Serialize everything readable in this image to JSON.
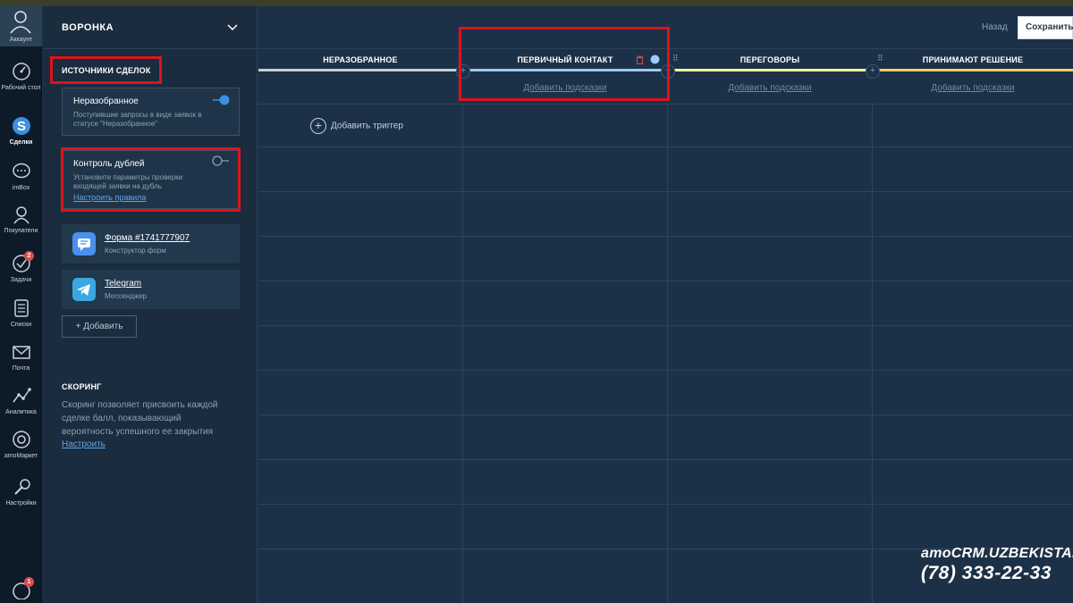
{
  "rail": {
    "account": "Аккаунт",
    "items": [
      {
        "label": "Рабочий стол",
        "icon": "dashboard-icon"
      },
      {
        "label": "Сделки",
        "icon": "deals-icon"
      },
      {
        "label": "imBox",
        "icon": "chat-icon"
      },
      {
        "label": "Покупатели",
        "icon": "customers-icon"
      },
      {
        "label": "Задачи",
        "icon": "tasks-icon",
        "badge": "2"
      },
      {
        "label": "Списки",
        "icon": "lists-icon"
      },
      {
        "label": "Почта",
        "icon": "mail-icon"
      },
      {
        "label": "Аналитика",
        "icon": "analytics-icon"
      },
      {
        "label": "amoМаркет",
        "icon": "market-icon"
      },
      {
        "label": "Настройки",
        "icon": "settings-icon"
      }
    ],
    "bottom_badge": "1"
  },
  "panel": {
    "title": "ВОРОНКА",
    "sources_title": "ИСТОЧНИКИ СДЕЛОК",
    "unsorted": {
      "title": "Неразобранное",
      "desc": "Поступившие запросы в виде заявок в статусе \"Неразобранное\"",
      "enabled": true
    },
    "duplicates": {
      "title": "Контроль дублей",
      "desc": "Установите параметры проверки входящей заявки на дубль",
      "link": "Настроить правила",
      "enabled": false
    },
    "sources": [
      {
        "name": "Форма #1741777907",
        "sub": "Конструктор форм",
        "icon": "form-icon"
      },
      {
        "name": "Telegram",
        "sub": "Мессенджер",
        "icon": "telegram-icon"
      }
    ],
    "add_label": "Добавить",
    "scoring": {
      "title": "СКОРИНГ",
      "desc": "Скоринг позволяет присвоить каждой сделке балл, показывающий вероятность успешного ее закрытия",
      "link": "Настроить"
    }
  },
  "header": {
    "back": "Назад",
    "save": "Сохранить"
  },
  "columns": [
    {
      "name": "НЕРАЗОБРАННОЕ",
      "color": "#c8cdd2",
      "hint": ""
    },
    {
      "name": "ПЕРВИЧНЫЙ КОНТАКТ",
      "color": "#99ccff",
      "hint": "Добавить подсказки"
    },
    {
      "name": "ПЕРЕГОВОРЫ",
      "color": "#ffff99",
      "hint": "Добавить подсказки"
    },
    {
      "name": "ПРИНИМАЮТ РЕШЕНИЕ",
      "color": "#ffcc66",
      "hint": "Добавить подсказки"
    }
  ],
  "add_trigger": "Добавить триггер",
  "watermark": {
    "line1": "amoCRM.UZBEKISTAN",
    "line2": "(78) 333-22-33"
  }
}
